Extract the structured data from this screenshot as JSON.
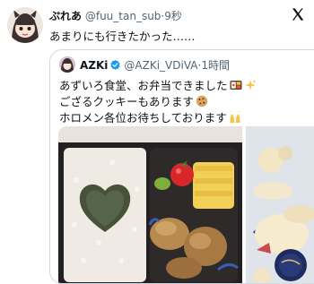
{
  "tweet": {
    "author_name": "ぷれあ",
    "handle": "@fuu_tan_sub",
    "separator": "·",
    "time": "9秒",
    "text": "あまりにも行きたかった……"
  },
  "quoted": {
    "author_name": "AZKi",
    "handle": "@AZKi_VDiVA",
    "separator": "·",
    "time": "1時間",
    "lines": [
      "あずいろ食堂、お弁当できました",
      "ござるクッキーもあります",
      "ホロメン各位お待ちしております"
    ]
  },
  "icons": {
    "logo": "x-logo-icon",
    "verified": "verified-badge-icon",
    "bento": "bento-box-icon",
    "sparkles": "sparkles-icon",
    "cookie": "cookie-icon",
    "raising_hands": "raising-hands-icon"
  },
  "colors": {
    "text": "#0f1419",
    "muted": "#536471",
    "verified": "#1d9bf0",
    "border": "#cfd9de"
  }
}
